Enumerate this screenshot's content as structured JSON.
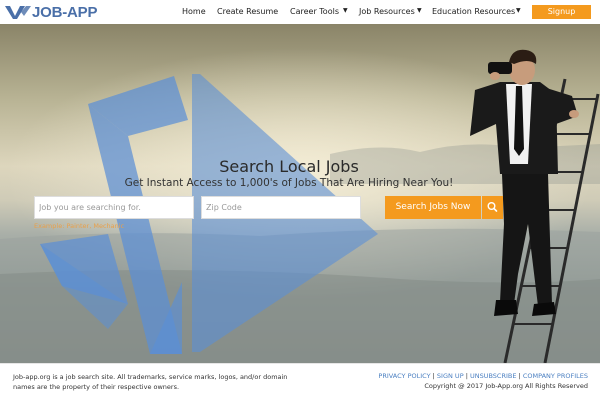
{
  "brand": {
    "logo_text": "JOB-APP",
    "color": "#4a6fa8"
  },
  "nav": {
    "home": "Home",
    "create_resume": "Create Resume",
    "career_tools": "Career Tools",
    "job_resources": "Job Resources",
    "education_resources": "Education Resources",
    "signup": "Signup"
  },
  "hero": {
    "title": "Search Local Jobs",
    "subtitle": "Get Instant Access to 1,000's of Jobs That Are Hiring Near You!",
    "job_placeholder": "Job you are searching for.",
    "zip_placeholder": "Zip Code",
    "example": "Example: Painter, Mechanic",
    "search_button": "Search Jobs Now"
  },
  "footer": {
    "disclaimer": "Job-app.org is a job search site. All trademarks, service marks, logos, and/or domain names are the property of their respective owners.",
    "links": [
      "PRIVACY POLICY",
      "SIGN UP",
      "UNSUBSCRIBE",
      "COMPANY PROFILES"
    ],
    "copyright": "Copyright @ 2017 Job-App.org All Rights Reserved"
  },
  "colors": {
    "accent": "#f49a1e",
    "link": "#4a7fc1",
    "watermark": "#5b8fd6"
  }
}
